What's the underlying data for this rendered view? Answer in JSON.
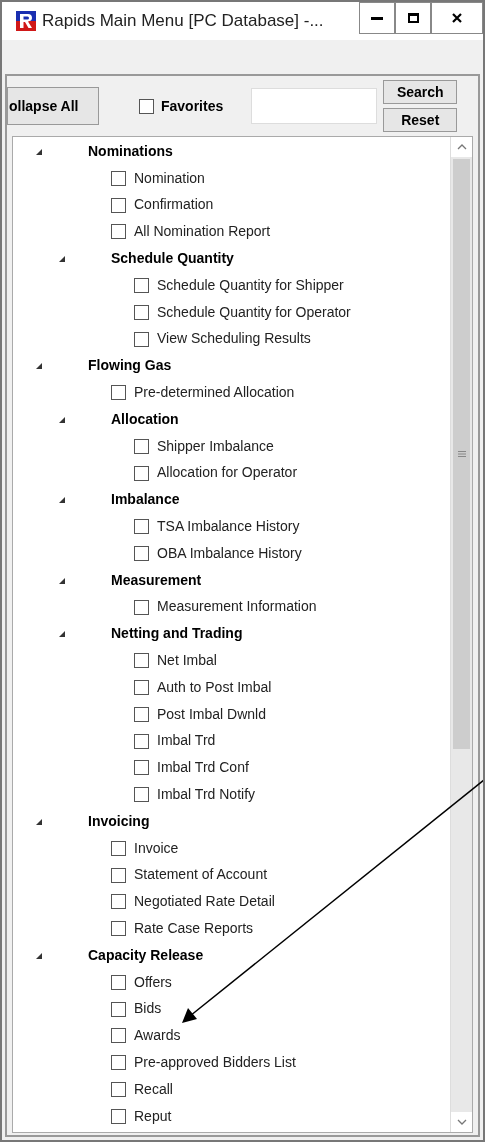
{
  "window": {
    "title": "Rapids Main Menu  [PC Database] -..."
  },
  "toolbar": {
    "collapse_button": "ollapse All",
    "favorites": {
      "label": "Favorites",
      "checked": false
    },
    "search_button": "Search",
    "reset_button": "Reset"
  },
  "tree": [
    {
      "label": "Nominations",
      "expanded": true,
      "children": [
        {
          "label": "Nomination",
          "checked": false
        },
        {
          "label": "Confirmation",
          "checked": false
        },
        {
          "label": "All Nomination Report",
          "checked": false
        },
        {
          "label": "Schedule Quantity",
          "expanded": true,
          "children": [
            {
              "label": "Schedule Quantity for Shipper",
              "checked": false
            },
            {
              "label": "Schedule Quantity for Operator",
              "checked": false
            },
            {
              "label": "View Scheduling Results",
              "checked": false
            }
          ]
        }
      ]
    },
    {
      "label": "Flowing Gas",
      "expanded": true,
      "children": [
        {
          "label": "Pre-determined Allocation",
          "checked": false
        },
        {
          "label": "Allocation",
          "expanded": true,
          "children": [
            {
              "label": "Shipper Imbalance",
              "checked": false
            },
            {
              "label": "Allocation for Operator",
              "checked": false
            }
          ]
        },
        {
          "label": "Imbalance",
          "expanded": true,
          "children": [
            {
              "label": "TSA Imbalance History",
              "checked": false
            },
            {
              "label": "OBA Imbalance History",
              "checked": false
            }
          ]
        },
        {
          "label": "Measurement",
          "expanded": true,
          "children": [
            {
              "label": "Measurement Information",
              "checked": false
            }
          ]
        },
        {
          "label": "Netting and Trading",
          "expanded": true,
          "children": [
            {
              "label": "Net Imbal",
              "checked": false
            },
            {
              "label": "Auth to Post Imbal",
              "checked": false
            },
            {
              "label": "Post Imbal Dwnld",
              "checked": false
            },
            {
              "label": "Imbal Trd",
              "checked": false
            },
            {
              "label": "Imbal Trd Conf",
              "checked": false
            },
            {
              "label": "Imbal Trd Notify",
              "checked": false
            }
          ]
        }
      ]
    },
    {
      "label": "Invoicing",
      "expanded": true,
      "children": [
        {
          "label": "Invoice",
          "checked": false
        },
        {
          "label": "Statement of Account",
          "checked": false
        },
        {
          "label": "Negotiated Rate Detail",
          "checked": false
        },
        {
          "label": "Rate Case Reports",
          "checked": false
        }
      ]
    },
    {
      "label": "Capacity Release",
      "expanded": true,
      "children": [
        {
          "label": "Offers",
          "checked": false
        },
        {
          "label": "Bids",
          "checked": false
        },
        {
          "label": "Awards",
          "checked": false
        },
        {
          "label": "Pre-approved Bidders List",
          "checked": false
        },
        {
          "label": "Recall",
          "checked": false
        },
        {
          "label": "Reput",
          "checked": false
        }
      ]
    }
  ]
}
